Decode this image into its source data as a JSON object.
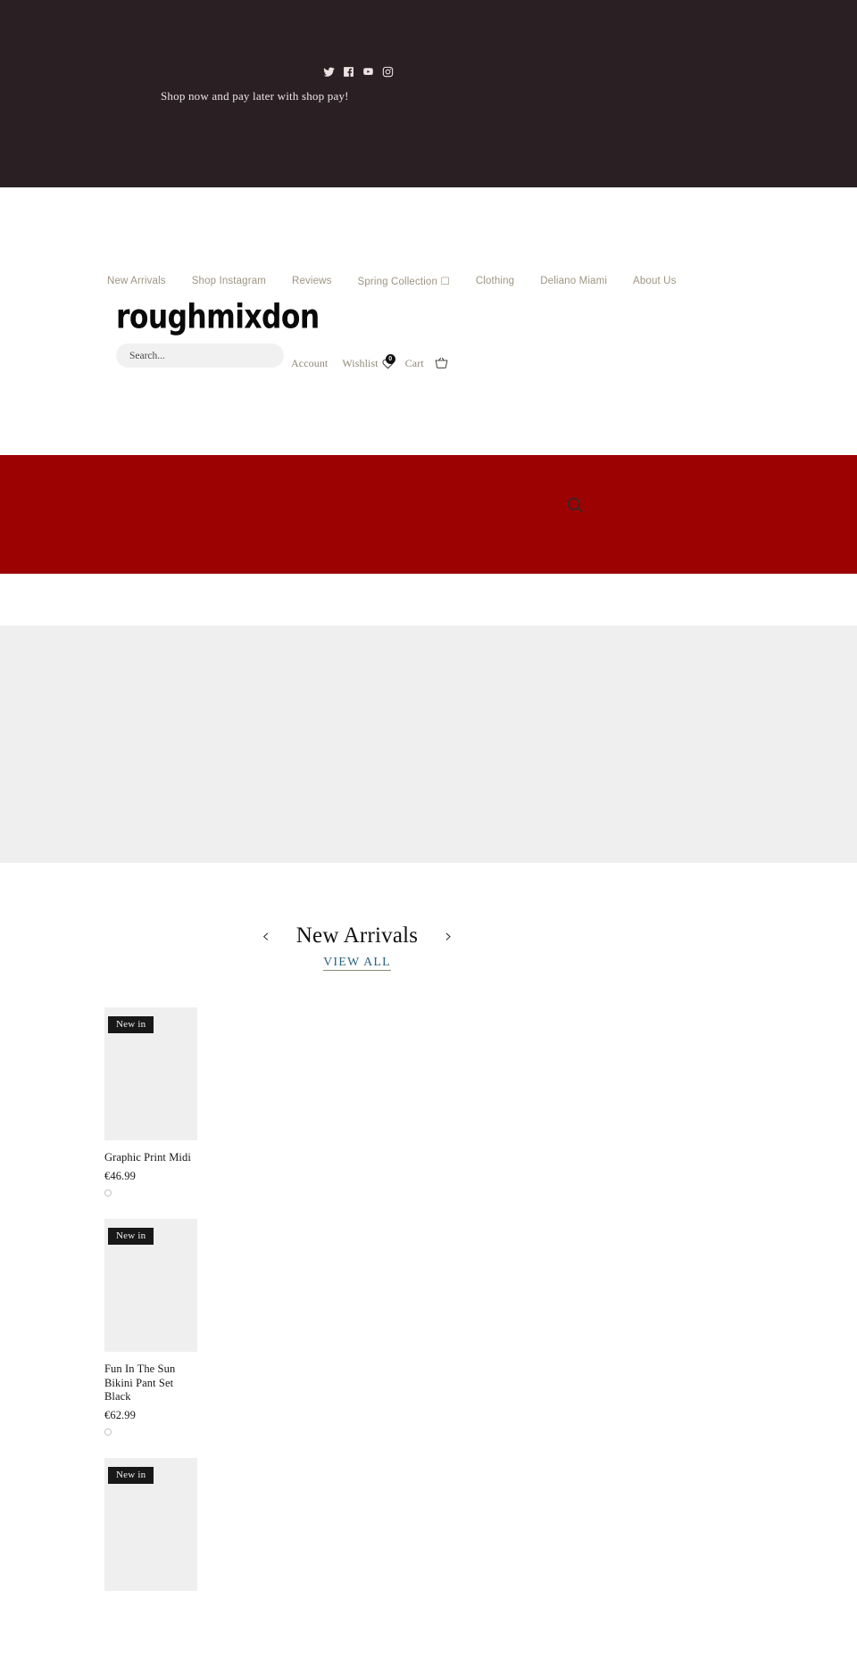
{
  "announcement": {
    "message": "Shop now and pay later with shop pay!",
    "socials": [
      {
        "name": "twitter-icon",
        "label": "Twitter"
      },
      {
        "name": "facebook-icon",
        "label": "Facebook"
      },
      {
        "name": "youtube-icon",
        "label": "YouTube"
      },
      {
        "name": "instagram-icon",
        "label": "Instagram"
      }
    ],
    "background": "#2a2024",
    "text_color": "#ede4e4"
  },
  "header": {
    "logo": "roughmixdon",
    "nav": [
      {
        "label": "New Arrivals"
      },
      {
        "label": "Shop Instagram"
      },
      {
        "label": "Reviews"
      },
      {
        "label": "Spring Collection ☐"
      },
      {
        "label": "Clothing"
      },
      {
        "label": "Deliano Miami"
      },
      {
        "label": "About Us"
      }
    ],
    "search": {
      "placeholder": "Search...",
      "value": ""
    },
    "utilities": {
      "account_label": "Account",
      "wishlist_label": "Wishlist",
      "wishlist_count": "0",
      "cart_label": "Cart"
    }
  },
  "banner": {
    "color": "#9d0203"
  },
  "hero": {
    "color": "#efefef"
  },
  "collection": {
    "title": "New Arrivals",
    "prev_arrow": "‹",
    "next_arrow": "›",
    "view_all": "VIEW ALL",
    "link_color": "#2d6480",
    "products": [
      {
        "badge": "New in",
        "title": "Graphic Print Midi",
        "price": "€46.99",
        "swatches": [
          "#ffffff"
        ]
      },
      {
        "badge": "New in",
        "title": "Fun In The Sun Bikini Pant Set Black",
        "price": "€62.99",
        "swatches": [
          "#ffffff"
        ]
      },
      {
        "badge": "New in",
        "title": "",
        "price": "",
        "swatches": []
      }
    ]
  }
}
